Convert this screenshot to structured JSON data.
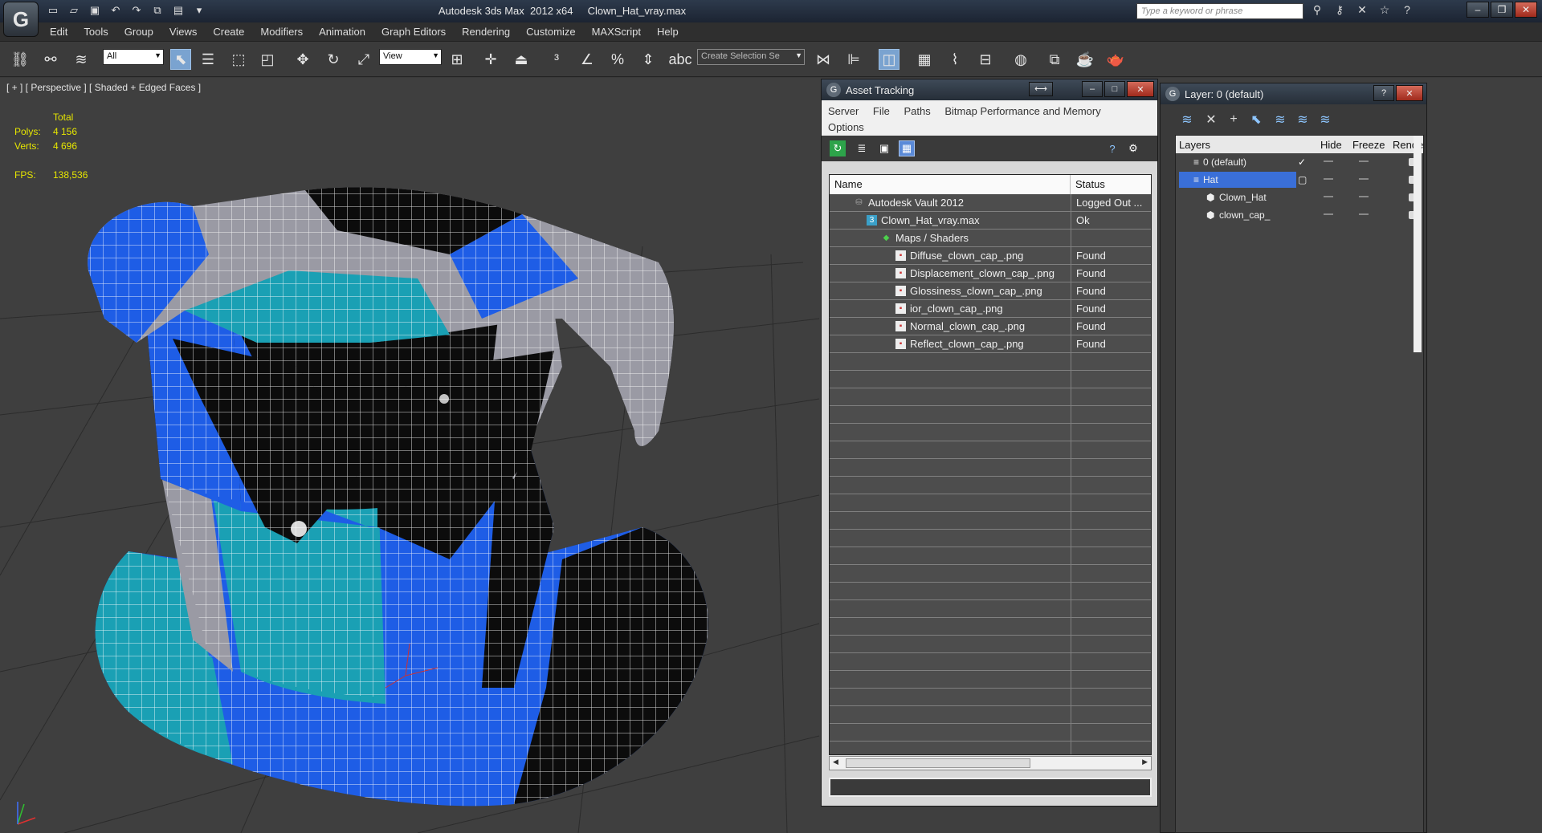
{
  "titlebar": {
    "title": "Autodesk 3ds Max  2012 x64     Clown_Hat_vray.max",
    "search_placeholder": "Type a keyword or phrase",
    "logo": "3ds-max-logo"
  },
  "menu": [
    "Edit",
    "Tools",
    "Group",
    "Views",
    "Create",
    "Modifiers",
    "Animation",
    "Graph Editors",
    "Rendering",
    "Customize",
    "MAXScript",
    "Help"
  ],
  "toolbar": {
    "selection_filter": "All",
    "reference_coord": "View",
    "named_selection": "Create Selection Se"
  },
  "viewport": {
    "label": "[ + ] [ Perspective ] [ Shaded + Edged Faces ]",
    "stats": {
      "total_label": "Total",
      "polys_label": "Polys:",
      "polys_value": "4 156",
      "verts_label": "Verts:",
      "verts_value": "4 696",
      "fps_label": "FPS:",
      "fps_value": "138,536"
    }
  },
  "asset_tracking": {
    "title": "Asset Tracking",
    "menu": [
      "Server",
      "File",
      "Paths",
      "Bitmap Performance and Memory",
      "Options"
    ],
    "columns": [
      "Name",
      "Status"
    ],
    "rows": [
      {
        "name": "Autodesk Vault 2012",
        "status": "Logged Out ..."
      },
      {
        "name": "Clown_Hat_vray.max",
        "status": "Ok"
      },
      {
        "name": "Maps / Shaders",
        "status": ""
      },
      {
        "name": "Diffuse_clown_cap_.png",
        "status": "Found"
      },
      {
        "name": "Displacement_clown_cap_.png",
        "status": "Found"
      },
      {
        "name": "Glossiness_clown_cap_.png",
        "status": "Found"
      },
      {
        "name": "ior_clown_cap_.png",
        "status": "Found"
      },
      {
        "name": "Normal_clown_cap_.png",
        "status": "Found"
      },
      {
        "name": "Reflect_clown_cap_.png",
        "status": "Found"
      }
    ]
  },
  "layer_manager": {
    "title": "Layer: 0 (default)",
    "columns": [
      "Layers",
      "Hide",
      "Freeze",
      "Rende"
    ],
    "rows": [
      {
        "name": "0 (default)"
      },
      {
        "name": "Hat"
      },
      {
        "name": "Clown_Hat"
      },
      {
        "name": "clown_cap_"
      }
    ]
  },
  "colors": {
    "viewport_bg": "#3f3f3f",
    "hat_blue": "#1e5de6",
    "hat_teal": "#1aa0b4",
    "hat_grey": "#9a9aa4",
    "hat_black": "#0c0c0c",
    "selection": "#3a6fd8",
    "stats_text": "#e6e600"
  }
}
